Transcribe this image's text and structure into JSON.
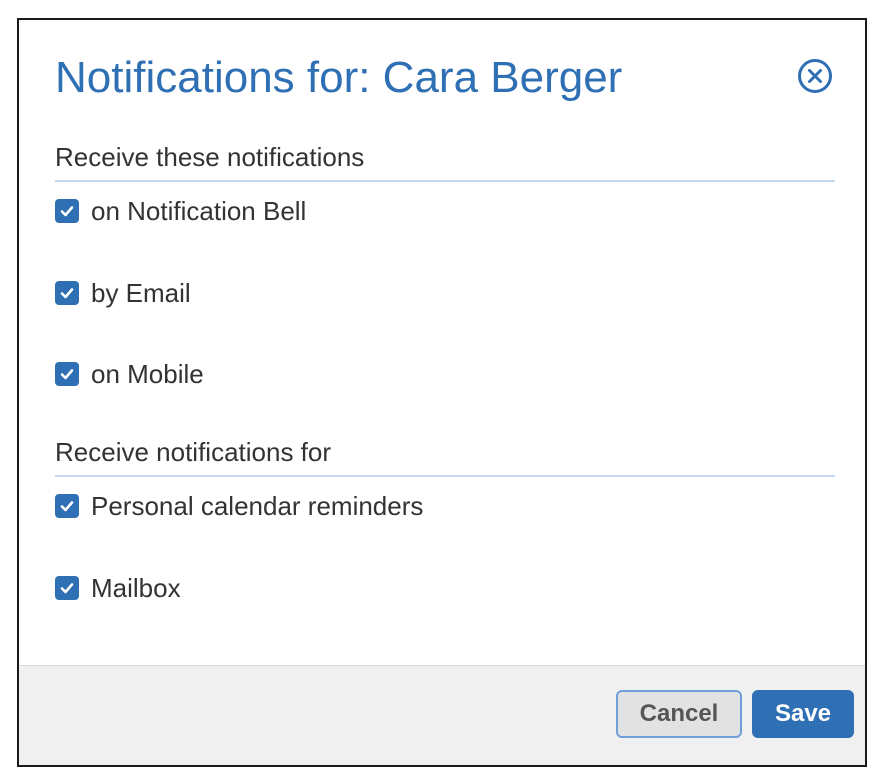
{
  "dialog": {
    "title": "Notifications for: Cara Berger",
    "close_icon": "close-circle-icon"
  },
  "channels": {
    "header": "Receive these notifications",
    "options": [
      {
        "label": "on Notification Bell",
        "checked": true
      },
      {
        "label": "by Email",
        "checked": true
      },
      {
        "label": "on Mobile",
        "checked": true
      }
    ]
  },
  "types": {
    "header": "Receive notifications for",
    "options": [
      {
        "label": "Personal calendar reminders",
        "checked": true
      },
      {
        "label": "Mailbox",
        "checked": true
      }
    ]
  },
  "footer": {
    "cancel_label": "Cancel",
    "save_label": "Save"
  },
  "colors": {
    "accent": "#2f6fb4",
    "divider": "#c5d8ee",
    "footer_bg": "#f0f0f0"
  }
}
